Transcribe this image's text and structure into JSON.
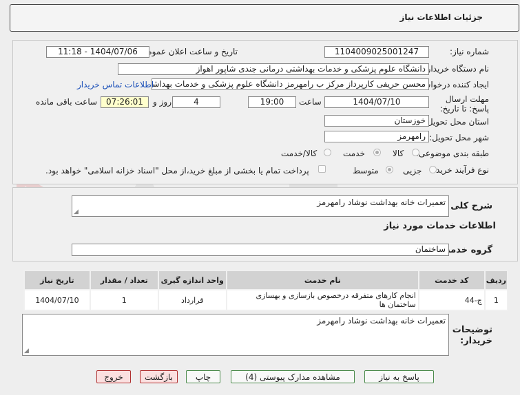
{
  "header": {
    "title": "جزئیات اطلاعات نیاز"
  },
  "info": {
    "need_number_label": "شماره نیاز:",
    "need_number": "1104009025001247",
    "announce_label": "تاریخ و ساعت اعلان عمومی:",
    "announce_value": "1404/07/06 - 11:18",
    "buyer_org_label": "نام دستگاه خریدار:",
    "buyer_org": "دانشگاه علوم پزشکی و خدمات بهداشتی درمانی جندی شاپور اهواز",
    "requester_label": "ایجاد کننده درخواست:",
    "requester": "محسن حریفی کارپرداز مرکز ب رامهرمز دانشگاه علوم پزشکی و خدمات بهداشتی درمانی جندی شاپور اهواز",
    "contact_link": "اطلاعات تماس خریدار",
    "deadline_label": "مهلت ارسال پاسخ: تا تاریخ:",
    "deadline_date": "1404/07/10",
    "time_label": "ساعت",
    "deadline_time": "19:00",
    "days_value": "4",
    "days_label": "روز و",
    "remaining_time": "07:26:01",
    "remaining_label": "ساعت باقی مانده",
    "province_label": "استان محل تحویل:",
    "province": "خوزستان",
    "city_label": "شهر محل تحویل:",
    "city": "رامهرمز",
    "category_label": "طبقه بندی موضوعی:",
    "category_options": [
      "کالا",
      "خدمت",
      "کالا/خدمت"
    ],
    "process_label": "نوع فرآیند خرید :",
    "process_options": [
      "جزیی",
      "متوسط"
    ],
    "payment_note": "پرداخت تمام یا بخشی از مبلغ خرید،از محل \"اسناد خزانه اسلامی\" خواهد بود."
  },
  "general_desc": {
    "label": "شرح کلی نیاز:",
    "value": "تعمیرات خانه بهداشت نوشاد رامهرمز"
  },
  "services_title": "اطلاعات خدمات مورد نیاز",
  "service_group": {
    "label": "گروه خدمت:",
    "value": "ساختمان"
  },
  "table": {
    "headers": [
      "ردیف",
      "کد خدمت",
      "نام خدمت",
      "واحد اندازه گیری",
      "تعداد / مقدار",
      "تاریخ نیاز"
    ],
    "rows": [
      [
        "1",
        "ج-44",
        "انجام کارهای متفرقه درخصوص بازسازی و بهسازی ساختمان ها",
        "قرارداد",
        "1",
        "1404/07/10"
      ]
    ]
  },
  "buyer_notes": {
    "label": "توضیحات خریدار:",
    "value": "تعمیرات خانه بهداشت نوشاد رامهرمز"
  },
  "buttons": {
    "reply": "پاسخ به نیاز",
    "attachments": "مشاهده مدارک پیوستی (4)",
    "print": "چاپ",
    "back": "بازگشت",
    "exit": "خروج"
  },
  "colors": {
    "link": "#1a4fb8",
    "highlight": "#ffffcc",
    "button_border": "#4a8a4a",
    "danger": "#b03030"
  }
}
